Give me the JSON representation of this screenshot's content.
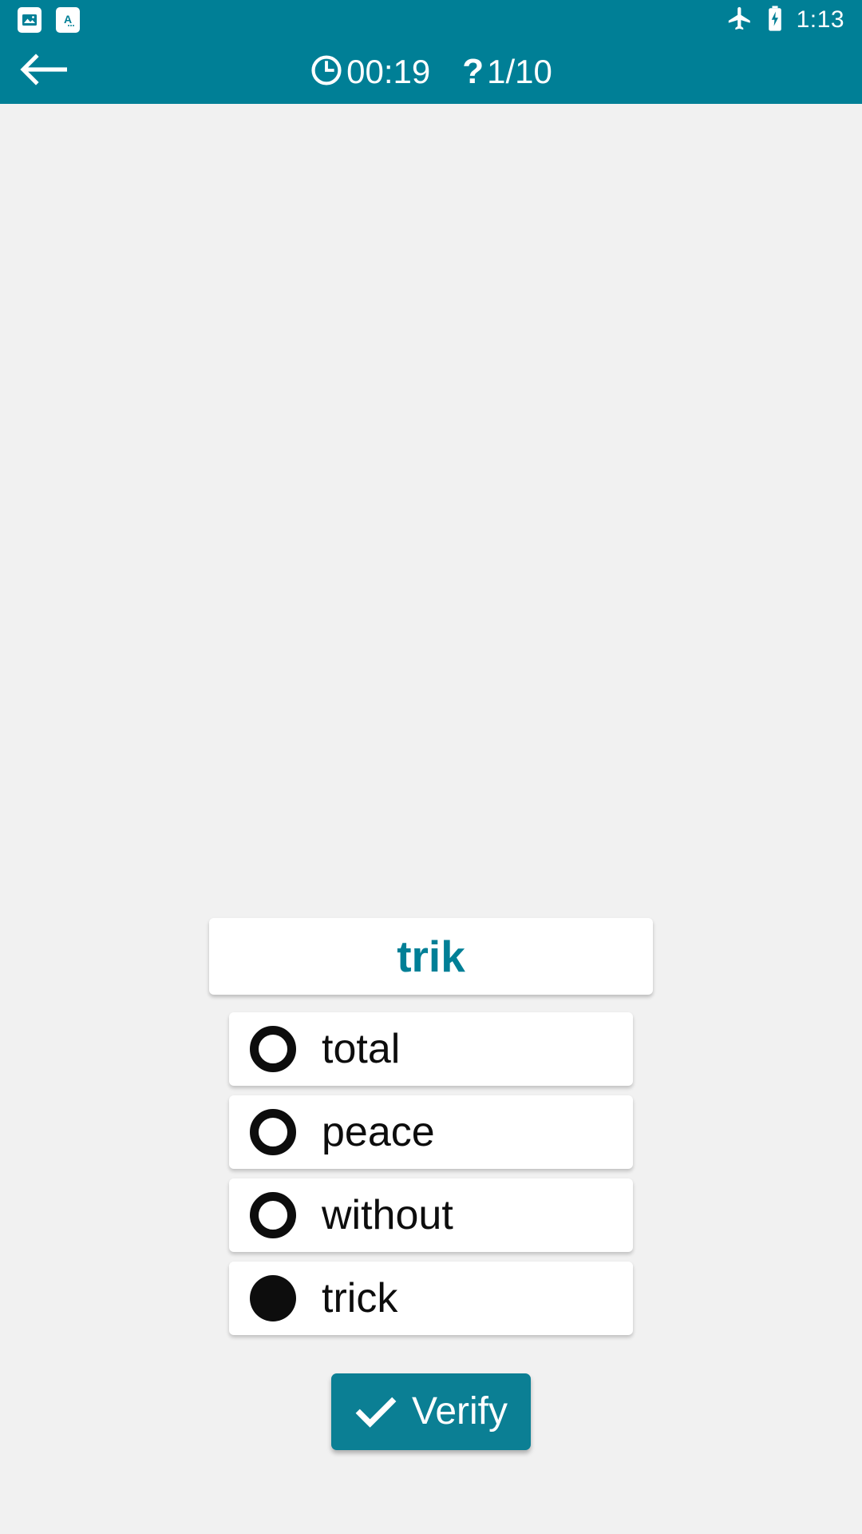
{
  "status_bar": {
    "notifications": [
      {
        "icon": "image-notification-icon"
      },
      {
        "icon": "translate-letter-a-notification-icon"
      }
    ],
    "airplane_mode_icon": "airplane-icon",
    "battery_icon": "battery-charging-icon",
    "time": "1:13"
  },
  "app_bar": {
    "back_icon": "back-arrow-icon",
    "timer_icon": "clock-icon",
    "timer": "00:19",
    "question_icon": "question-mark-icon",
    "question_counter": "1/10",
    "background_color": "#007f96"
  },
  "quiz": {
    "question_word": "trik",
    "question_word_color": "#007f96",
    "options": [
      {
        "label": "total",
        "selected": false
      },
      {
        "label": "peace",
        "selected": false
      },
      {
        "label": "without",
        "selected": false
      },
      {
        "label": "trick",
        "selected": true
      }
    ],
    "verify_button": {
      "label": "Verify",
      "icon": "checkmark-icon",
      "color": "#0b7f94"
    }
  }
}
